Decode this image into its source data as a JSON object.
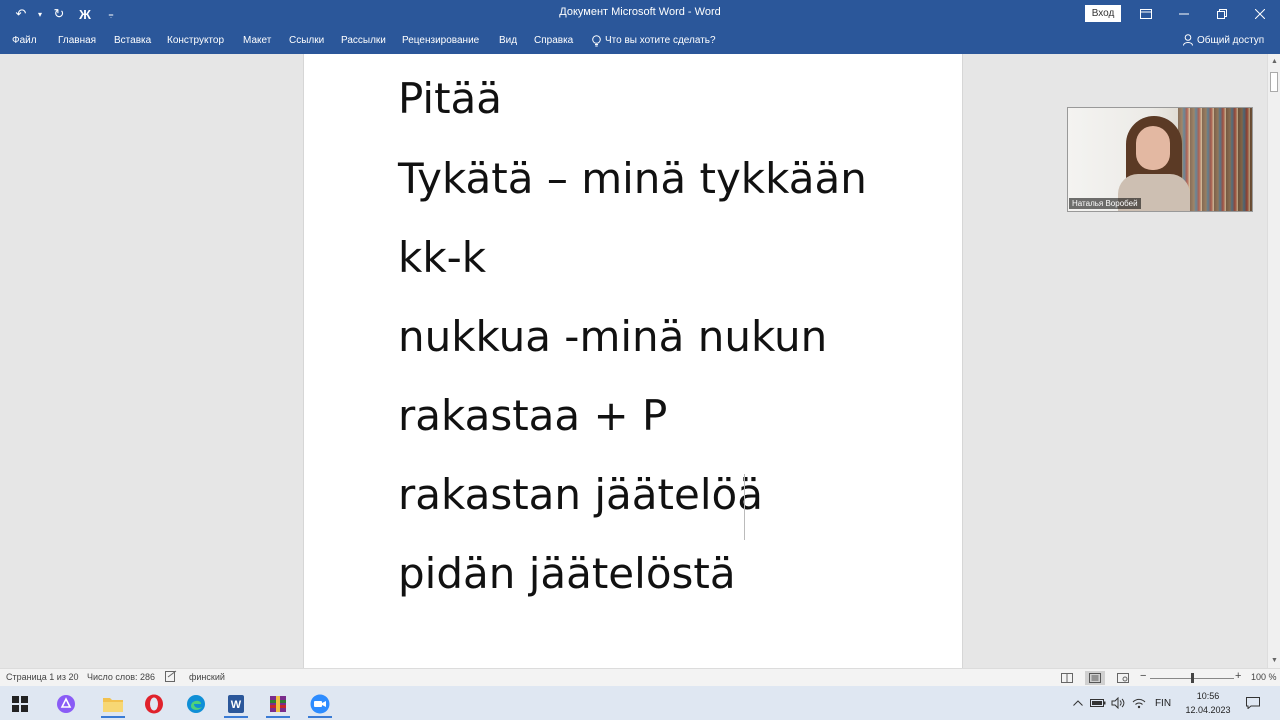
{
  "window": {
    "title": "Документ Microsoft Word  -  Word",
    "signin_label": "Вход",
    "qat": {
      "undo": "↶",
      "undo_dropdown": "▾",
      "redo": "↻",
      "bold": "Ж",
      "customize": "⩦"
    }
  },
  "ribbon": {
    "tabs": [
      "Файл",
      "Главная",
      "Вставка",
      "Конструктор",
      "Макет",
      "Ссылки",
      "Рассылки",
      "Рецензирование",
      "Вид",
      "Справка"
    ],
    "tell_me": "Что вы хотите сделать?",
    "share": "Общий доступ"
  },
  "document": {
    "lines": [
      "Pitää",
      "Tykätä – minä tykkään",
      "kk-k",
      "nukkua -minä nukun",
      "rakastaa + P",
      "rakastan jäätelöä",
      "pidän jäätelöstä"
    ]
  },
  "video": {
    "participant_name": "Наталья Воробей"
  },
  "statusbar": {
    "page": "Страница 1 из 20",
    "words": "Число слов: 286",
    "language": "финский",
    "zoom": "100 %",
    "zoom_percent": 100
  },
  "taskbar": {
    "apps": [
      "windows-start",
      "alice",
      "file-explorer",
      "opera",
      "edge",
      "word",
      "winrar",
      "zoom"
    ],
    "input_language": "FIN",
    "time": "10:56",
    "date": "12.04.2023"
  },
  "colors": {
    "word_blue": "#2b579a",
    "taskbar": "#dfe7f2"
  }
}
